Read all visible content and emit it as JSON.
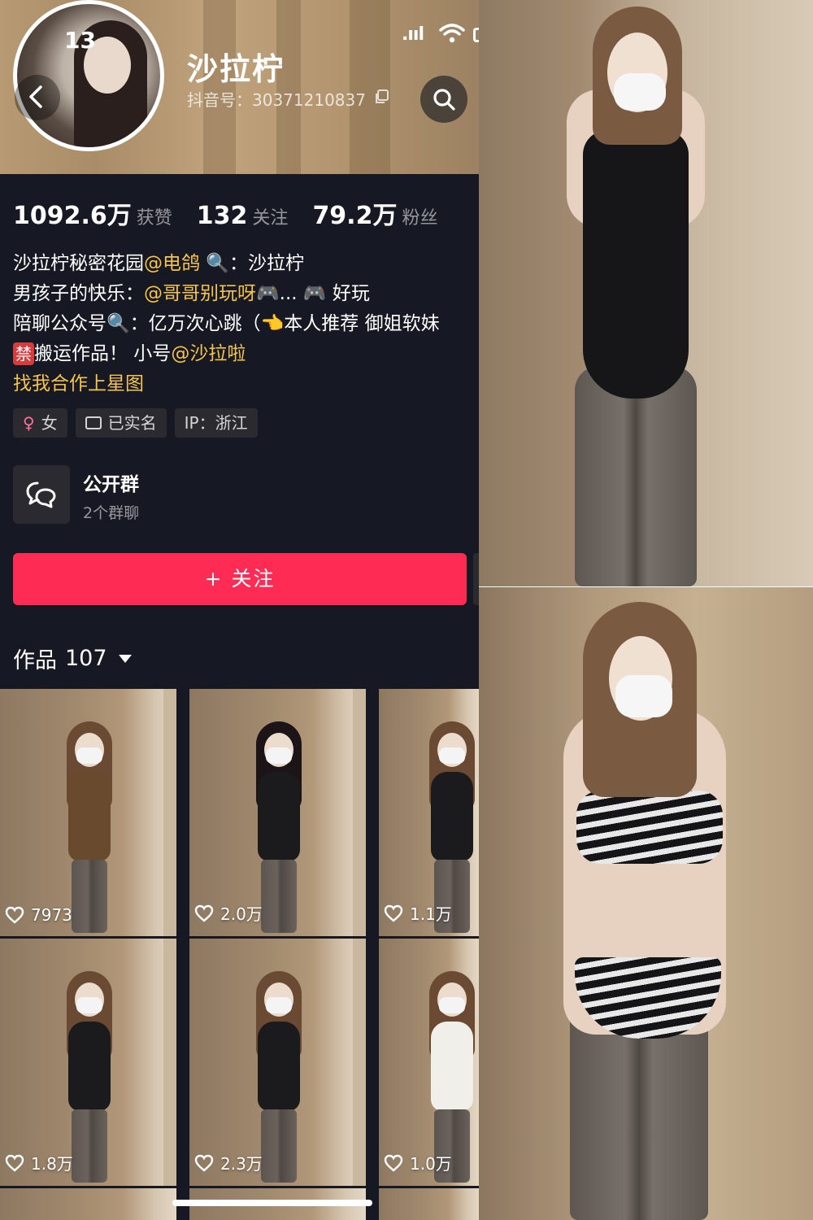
{
  "status": {
    "time_fragment": "13"
  },
  "profile": {
    "name": "沙拉柠",
    "douyin_id": "抖音号：30371210837"
  },
  "stats": [
    {
      "num": "1092.6万",
      "label": "获赞"
    },
    {
      "num": "132",
      "label": "关注"
    },
    {
      "num": "79.2万",
      "label": "粉丝"
    }
  ],
  "bio": {
    "line1_a": "沙拉柠秘密花园",
    "line1_mention": "@电鸽",
    "line1_b": "🔍：沙拉柠",
    "line2_a": "男孩子的快乐：",
    "line2_mention": "@哥哥别玩呀",
    "line2_b": "🎮... 🎮 好玩",
    "line3": "陪聊公众号🔍：亿万次心跳（👈本人推荐 御姐软妹",
    "line4_ban": "禁",
    "line4_a": "搬运作品！ 小号",
    "line4_mention": "@沙拉啦",
    "line5_link": "找我合作上星图"
  },
  "tags": [
    {
      "label": "女",
      "icon": "female-icon"
    },
    {
      "label": "已实名",
      "icon": "id-card-icon"
    },
    {
      "label": "IP：浙江"
    }
  ],
  "group": {
    "title": "公开群",
    "subtitle": "2个群聊"
  },
  "follow_button": {
    "label": "+ 关注"
  },
  "works": {
    "label": "作品",
    "count": "107"
  },
  "videos": [
    {
      "likes": "7973"
    },
    {
      "likes": "2.0万"
    },
    {
      "likes": "1.1万"
    },
    {
      "likes": "1.8万"
    },
    {
      "likes": "2.3万"
    },
    {
      "likes": "1.0万"
    }
  ],
  "colors": {
    "accent": "#fe2c55",
    "mention": "#f5c44a",
    "background": "#161823"
  }
}
